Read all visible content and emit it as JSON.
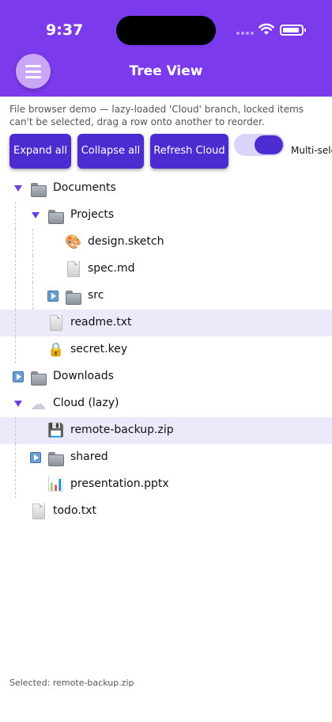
{
  "status_bar": {
    "time": "9:37"
  },
  "header": {
    "title": "Tree View",
    "menu_icon": "hamburger-icon"
  },
  "description": "File browser demo — lazy-loaded 'Cloud' branch, locked items can't be selected, drag a row onto another to reorder.",
  "toolbar": {
    "expand_all": "Expand all",
    "collapse_all": "Collapse all",
    "refresh_cloud": "Refresh Cloud",
    "multi_select_label": "Multi-sele",
    "multi_select_on": true
  },
  "tree": {
    "nodes": [
      {
        "label": "Documents",
        "icon": "folder-icon",
        "depth": 0,
        "toggle": "expanded"
      },
      {
        "label": "Projects",
        "icon": "folder-icon",
        "depth": 1,
        "toggle": "expanded"
      },
      {
        "label": "design.sketch",
        "icon": "palette-icon",
        "depth": 2,
        "toggle": "none"
      },
      {
        "label": "spec.md",
        "icon": "file-icon",
        "depth": 2,
        "toggle": "none"
      },
      {
        "label": "src",
        "icon": "folder-icon",
        "depth": 2,
        "toggle": "collapsed"
      },
      {
        "label": "readme.txt",
        "icon": "file-icon",
        "depth": 1,
        "toggle": "none",
        "selected": true
      },
      {
        "label": "secret.key",
        "icon": "lock-icon",
        "depth": 1,
        "toggle": "none"
      },
      {
        "label": "Downloads",
        "icon": "folder-icon",
        "depth": 0,
        "toggle": "collapsed"
      },
      {
        "label": "Cloud (lazy)",
        "icon": "cloud-icon",
        "depth": 0,
        "toggle": "expanded"
      },
      {
        "label": "remote-backup.zip",
        "icon": "floppy-disk-icon",
        "depth": 1,
        "toggle": "none",
        "selected": true
      },
      {
        "label": "shared",
        "icon": "folder-icon",
        "depth": 1,
        "toggle": "collapsed"
      },
      {
        "label": "presentation.pptx",
        "icon": "bar-chart-icon",
        "depth": 1,
        "toggle": "none"
      },
      {
        "label": "todo.txt",
        "icon": "file-icon",
        "depth": 0,
        "toggle": "none"
      }
    ]
  },
  "footer": {
    "selected_text": "Selected: remote-backup.zip"
  },
  "colors": {
    "accent": "#7c3aed",
    "button": "#4c2bd1",
    "selected_row": "#ece9fb"
  }
}
